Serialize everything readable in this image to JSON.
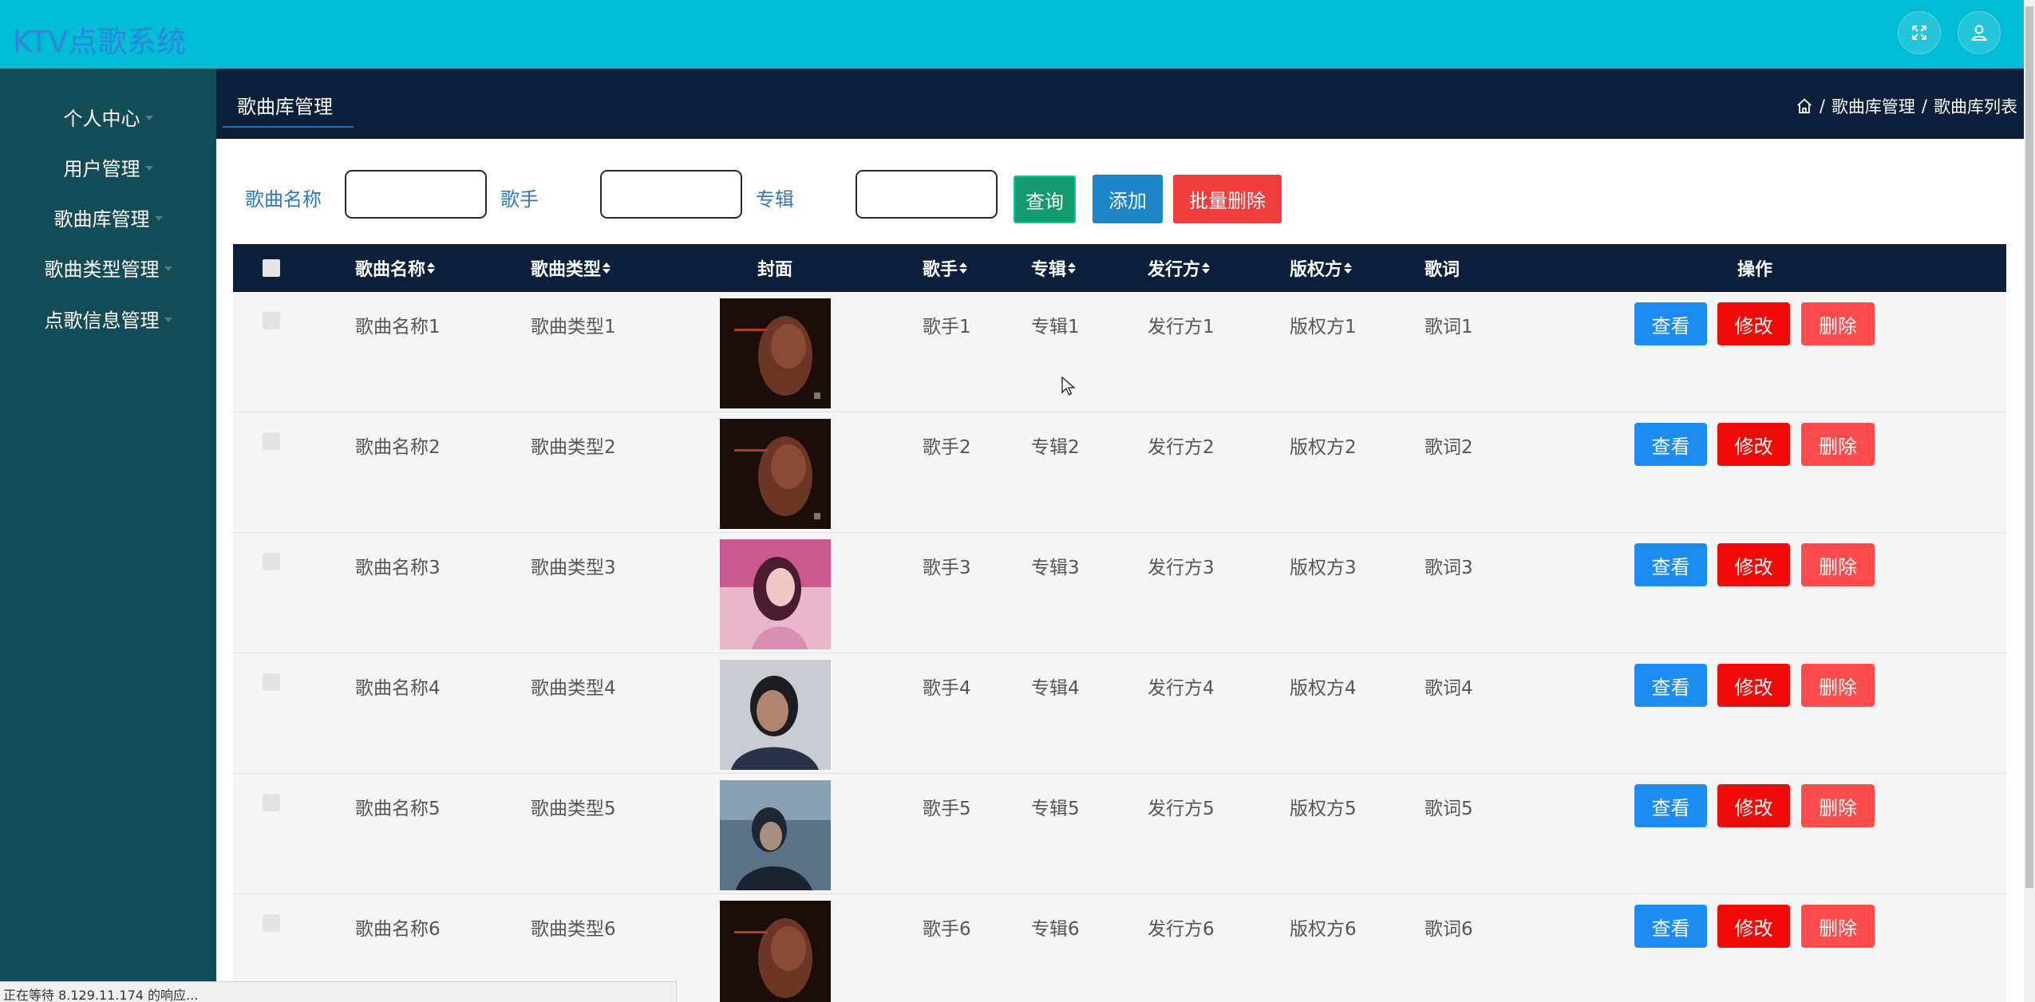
{
  "app": {
    "title": "KTV点歌系统"
  },
  "header": {
    "icons": [
      "fullscreen-icon",
      "user-icon"
    ]
  },
  "sidebar": {
    "items": [
      {
        "label": "个人中心"
      },
      {
        "label": "用户管理"
      },
      {
        "label": "歌曲库管理"
      },
      {
        "label": "歌曲类型管理"
      },
      {
        "label": "点歌信息管理"
      }
    ]
  },
  "page": {
    "tab_title": "歌曲库管理",
    "breadcrumb": {
      "sep": "/",
      "level1": "歌曲库管理",
      "level2": "歌曲库列表"
    }
  },
  "search": {
    "song_name_label": "歌曲名称",
    "song_name_value": "",
    "singer_label": "歌手",
    "singer_value": "",
    "album_label": "专辑",
    "album_value": "",
    "query_button": "查询",
    "add_button": "添加",
    "batch_delete_button": "批量删除"
  },
  "table": {
    "columns": {
      "name": "歌曲名称",
      "type": "歌曲类型",
      "cover": "封面",
      "singer": "歌手",
      "album": "专辑",
      "publisher": "发行方",
      "copyright": "版权方",
      "lyrics": "歌词",
      "actions": "操作"
    },
    "actions": {
      "view": "查看",
      "edit": "修改",
      "delete": "删除"
    },
    "rows": [
      {
        "name": "歌曲名称1",
        "type": "歌曲类型1",
        "singer": "歌手1",
        "album": "专辑1",
        "publisher": "发行方1",
        "copyright": "版权方1",
        "lyrics": "歌词1"
      },
      {
        "name": "歌曲名称2",
        "type": "歌曲类型2",
        "singer": "歌手2",
        "album": "专辑2",
        "publisher": "发行方2",
        "copyright": "版权方2",
        "lyrics": "歌词2"
      },
      {
        "name": "歌曲名称3",
        "type": "歌曲类型3",
        "singer": "歌手3",
        "album": "专辑3",
        "publisher": "发行方3",
        "copyright": "版权方3",
        "lyrics": "歌词3"
      },
      {
        "name": "歌曲名称4",
        "type": "歌曲类型4",
        "singer": "歌手4",
        "album": "专辑4",
        "publisher": "发行方4",
        "copyright": "版权方4",
        "lyrics": "歌词4"
      },
      {
        "name": "歌曲名称5",
        "type": "歌曲类型5",
        "singer": "歌手5",
        "album": "专辑5",
        "publisher": "发行方5",
        "copyright": "版权方5",
        "lyrics": "歌词5"
      },
      {
        "name": "歌曲名称6",
        "type": "歌曲类型6",
        "singer": "歌手6",
        "album": "专辑6",
        "publisher": "发行方6",
        "copyright": "版权方6",
        "lyrics": "歌词6"
      }
    ]
  },
  "status_bar": {
    "text": "正在等待 8.129.11.174 的响应..."
  },
  "colors": {
    "header_bg": "#00bcd4",
    "sidebar_bg": "#134b56",
    "table_head_bg": "#0c1f3a",
    "view_btn": "#1d8cf0",
    "edit_btn": "#f10a0a",
    "delete_btn": "#ff4b4b"
  }
}
